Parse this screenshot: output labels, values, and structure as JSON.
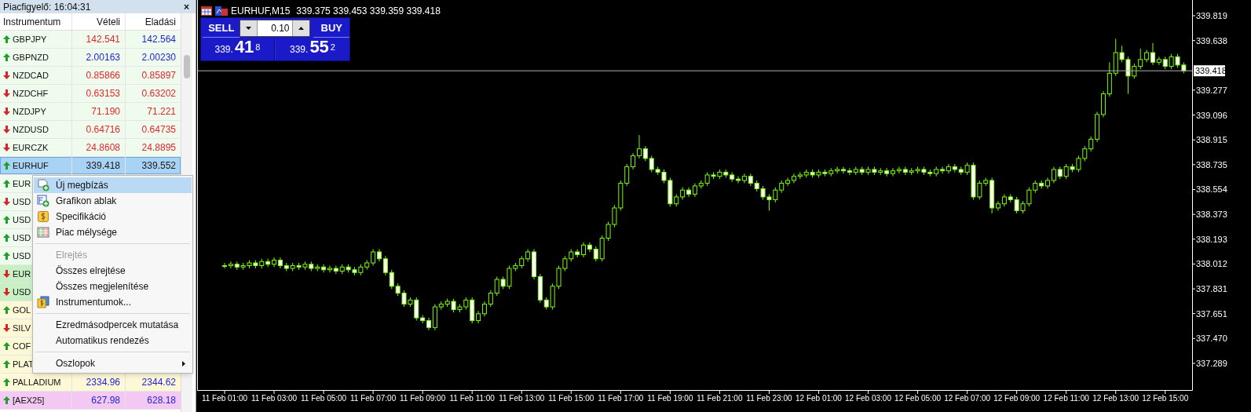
{
  "watch": {
    "title": "Piacfigyelő: 16:04:31",
    "close": "×",
    "columns": [
      "Instrumentum",
      "Vételi",
      "Eladási"
    ],
    "rows": [
      {
        "symbol": "GBPJPY",
        "up": true,
        "color": "#effbec",
        "selected": false,
        "bid": {
          "text": "142.541",
          "color": "#e0262e"
        },
        "ask": {
          "text": "142.564",
          "color": "#1f1fd0"
        }
      },
      {
        "symbol": "GBPNZD",
        "up": true,
        "color": "#effbec",
        "selected": false,
        "bid": {
          "text": "2.00163",
          "color": "#1f1fd0"
        },
        "ask": {
          "text": "2.00230",
          "color": "#1f1fd0"
        }
      },
      {
        "symbol": "NZDCAD",
        "up": false,
        "color": "#effbec",
        "selected": false,
        "bid": {
          "text": "0.85866",
          "color": "#e0262e"
        },
        "ask": {
          "text": "0.85897",
          "color": "#e0262e"
        }
      },
      {
        "symbol": "NZDCHF",
        "up": false,
        "color": "#effbec",
        "selected": false,
        "bid": {
          "text": "0.63153",
          "color": "#e0262e"
        },
        "ask": {
          "text": "0.63202",
          "color": "#e0262e"
        }
      },
      {
        "symbol": "NZDJPY",
        "up": false,
        "color": "#effbec",
        "selected": false,
        "bid": {
          "text": "71.190",
          "color": "#e0262e"
        },
        "ask": {
          "text": "71.221",
          "color": "#e0262e"
        }
      },
      {
        "symbol": "NZDUSD",
        "up": false,
        "color": "#effbec",
        "selected": false,
        "bid": {
          "text": "0.64716",
          "color": "#e0262e"
        },
        "ask": {
          "text": "0.64735",
          "color": "#e0262e"
        }
      },
      {
        "symbol": "EURCZK",
        "up": false,
        "color": "#effbec",
        "selected": false,
        "bid": {
          "text": "24.8608",
          "color": "#e0262e"
        },
        "ask": {
          "text": "24.8895",
          "color": "#e0262e"
        }
      },
      {
        "symbol": "EURHUF",
        "up": true,
        "color": "#a9d3f5",
        "selected": true,
        "bid": {
          "text": "339.418",
          "color": "#1a1a1a"
        },
        "ask": {
          "text": "339.552",
          "color": "#1a1a1a"
        }
      },
      {
        "symbol": "EUR",
        "up": true,
        "color": "#effbec",
        "selected": false
      },
      {
        "symbol": "USD",
        "up": false,
        "color": "#effbec",
        "selected": false
      },
      {
        "symbol": "USD",
        "up": true,
        "color": "#effbec",
        "selected": false
      },
      {
        "symbol": "USD",
        "up": true,
        "color": "#effbec",
        "selected": false
      },
      {
        "symbol": "USD",
        "up": true,
        "color": "#effbec",
        "selected": false
      },
      {
        "symbol": "EUR",
        "up": false,
        "color": "#c9f0c4",
        "selected": false
      },
      {
        "symbol": "USD",
        "up": false,
        "color": "#c9f0c4",
        "selected": false
      },
      {
        "symbol": "GOL",
        "up": true,
        "color": "#fdf8d6",
        "selected": false
      },
      {
        "symbol": "SILV",
        "up": false,
        "color": "#fdf8d6",
        "selected": false
      },
      {
        "symbol": "COF",
        "up": true,
        "color": "#fdf8d6",
        "selected": false
      },
      {
        "symbol": "PLAT",
        "up": true,
        "color": "#fdf8d6",
        "selected": false
      },
      {
        "symbol": "PALLADIUM",
        "up": true,
        "color": "#fdf8d6",
        "selected": false,
        "bid": {
          "text": "2334.96",
          "color": "#1f1fd0"
        },
        "ask": {
          "text": "2344.62",
          "color": "#1f1fd0"
        }
      },
      {
        "symbol": "[AEX25]",
        "up": true,
        "color": "#f3c8f3",
        "selected": false,
        "bid": {
          "text": "627.98",
          "color": "#1f1fd0"
        },
        "ask": {
          "text": "628.18",
          "color": "#1f1fd0"
        }
      }
    ]
  },
  "context_menu": {
    "items": [
      {
        "kind": "item",
        "label": "Új megbízás",
        "selected": true
      },
      {
        "kind": "item",
        "label": "Grafikon ablak",
        "selected": false
      },
      {
        "kind": "item",
        "label": "Specifikáció",
        "selected": false
      },
      {
        "kind": "item",
        "label": "Piac mélysége",
        "selected": false
      },
      {
        "kind": "separator"
      },
      {
        "kind": "disabled",
        "label": "Elrejtés",
        "selected": false
      },
      {
        "kind": "item",
        "label": "Összes elrejtése",
        "selected": false
      },
      {
        "kind": "item",
        "label": "Összes megjelenítése",
        "selected": false
      },
      {
        "kind": "item",
        "label": "Instrumentumok...",
        "selected": false
      },
      {
        "kind": "separator"
      },
      {
        "kind": "item",
        "label": "Ezredmásodpercek mutatása",
        "selected": false
      },
      {
        "kind": "item",
        "label": "Automatikus rendezés",
        "selected": false
      },
      {
        "kind": "separator"
      },
      {
        "kind": "submenu",
        "label": "Oszlopok",
        "selected": false
      }
    ]
  },
  "chart": {
    "title": "EURHUF,M15",
    "ohlc": "339.375 339.453 339.359 339.418",
    "trade_panel": {
      "sell": "SELL",
      "buy": "BUY",
      "lot": "0.10",
      "sell_price": {
        "big": "339.",
        "main": "41",
        "small": "8"
      },
      "buy_price": {
        "big": "339.",
        "main": "55",
        "small": "2"
      }
    },
    "chart_data": {
      "type": "candlestick",
      "ylim": [
        337.095,
        339.933
      ],
      "categories": [
        "11 Feb 01:00",
        null,
        null,
        null,
        null,
        null,
        null,
        null,
        "11 Feb 03:00",
        null,
        null,
        null,
        null,
        null,
        null,
        null,
        "11 Feb 05:00",
        null,
        null,
        null,
        null,
        null,
        null,
        null,
        "11 Feb 07:00",
        null,
        null,
        null,
        null,
        null,
        null,
        null,
        "11 Feb 09:00",
        null,
        null,
        null,
        null,
        null,
        null,
        null,
        "11 Feb 11:00",
        null,
        null,
        null,
        null,
        null,
        null,
        null,
        "11 Feb 13:00",
        null,
        null,
        null,
        null,
        null,
        null,
        null,
        "11 Feb 15:00",
        null,
        null,
        null,
        null,
        null,
        null,
        null,
        "11 Feb 17:00",
        null,
        null,
        null,
        null,
        null,
        null,
        null,
        "11 Feb 19:00",
        null,
        null,
        null,
        null,
        null,
        null,
        null,
        "11 Feb 21:00",
        null,
        null,
        null,
        null,
        null,
        null,
        null,
        "11 Feb 23:00",
        null,
        null,
        null,
        null,
        null,
        null,
        null,
        "12 Feb 01:00",
        null,
        null,
        null,
        null,
        null,
        null,
        null,
        "12 Feb 03:00",
        null,
        null,
        null,
        null,
        null,
        null,
        null,
        "12 Feb 05:00",
        null,
        null,
        null,
        null,
        null,
        null,
        null,
        "12 Feb 07:00",
        null,
        null,
        null,
        null,
        null,
        null,
        null,
        "12 Feb 09:00",
        null,
        null,
        null,
        null,
        null,
        null,
        null,
        "12 Feb 11:00",
        null,
        null,
        null,
        null,
        null,
        null,
        null,
        "12 Feb 13:00",
        null,
        null,
        null,
        null,
        null,
        null,
        null,
        "12 Feb 15:00",
        null,
        null,
        null
      ],
      "yticks": [
        {
          "value": 339.819,
          "label": "339.819"
        },
        {
          "value": 339.638,
          "label": "339.638"
        },
        {
          "value": 339.277,
          "label": "339.277"
        },
        {
          "value": 339.096,
          "label": "339.096"
        },
        {
          "value": 338.915,
          "label": "338.915"
        },
        {
          "value": 338.735,
          "label": "338.735"
        },
        {
          "value": 338.554,
          "label": "338.554"
        },
        {
          "value": 338.373,
          "label": "338.373"
        },
        {
          "value": 338.193,
          "label": "338.193"
        },
        {
          "value": 338.012,
          "label": "338.012"
        },
        {
          "value": 337.831,
          "label": "337.831"
        },
        {
          "value": 337.651,
          "label": "337.651"
        },
        {
          "value": 337.47,
          "label": "337.470"
        },
        {
          "value": 337.289,
          "label": "337.289"
        }
      ],
      "ref_lines": [
        {
          "axis": "y",
          "value": 339.418,
          "label": "339.418"
        }
      ],
      "ohlc": [
        [
          338.0,
          338.02,
          337.98,
          338.0
        ],
        [
          338.0,
          338.03,
          337.98,
          338.01
        ],
        [
          338.01,
          338.03,
          337.97,
          337.99
        ],
        [
          337.99,
          338.02,
          337.97,
          338.0
        ],
        [
          338.0,
          338.04,
          337.98,
          338.02
        ],
        [
          338.02,
          338.04,
          337.98,
          338.0
        ],
        [
          338.0,
          338.05,
          337.98,
          338.03
        ],
        [
          338.03,
          338.05,
          337.99,
          338.01
        ],
        [
          338.01,
          338.06,
          337.99,
          338.04
        ],
        [
          338.04,
          338.06,
          337.98,
          338.0
        ],
        [
          338.0,
          338.02,
          337.96,
          337.98
        ],
        [
          337.98,
          338.02,
          337.96,
          338.0
        ],
        [
          338.0,
          338.02,
          337.97,
          337.99
        ],
        [
          337.99,
          338.03,
          337.97,
          338.01
        ],
        [
          338.01,
          338.03,
          337.96,
          337.98
        ],
        [
          337.98,
          338.01,
          337.96,
          337.99
        ],
        [
          337.99,
          338.01,
          337.95,
          337.97
        ],
        [
          337.97,
          338.0,
          337.95,
          337.98
        ],
        [
          337.98,
          338.0,
          337.94,
          337.96
        ],
        [
          337.96,
          338.01,
          337.94,
          337.99
        ],
        [
          337.99,
          338.01,
          337.95,
          337.97
        ],
        [
          337.97,
          337.99,
          337.93,
          337.95
        ],
        [
          337.95,
          338.01,
          337.93,
          337.99
        ],
        [
          337.99,
          338.04,
          337.97,
          338.02
        ],
        [
          338.02,
          338.12,
          338.0,
          338.1
        ],
        [
          338.1,
          338.12,
          338.03,
          338.05
        ],
        [
          338.05,
          338.07,
          337.93,
          337.95
        ],
        [
          337.95,
          337.97,
          337.83,
          337.85
        ],
        [
          337.85,
          337.87,
          337.78,
          337.8
        ],
        [
          337.8,
          337.82,
          337.7,
          337.72
        ],
        [
          337.72,
          337.77,
          337.7,
          337.75
        ],
        [
          337.75,
          337.77,
          337.6,
          337.62
        ],
        [
          337.62,
          337.64,
          337.58,
          337.6
        ],
        [
          337.6,
          337.62,
          337.53,
          337.55
        ],
        [
          337.55,
          337.72,
          337.53,
          337.7
        ],
        [
          337.7,
          337.74,
          337.68,
          337.72
        ],
        [
          337.72,
          337.76,
          337.7,
          337.74
        ],
        [
          337.74,
          337.76,
          337.66,
          337.68
        ],
        [
          337.68,
          337.72,
          337.66,
          337.7
        ],
        [
          337.7,
          337.77,
          337.68,
          337.75
        ],
        [
          337.75,
          337.77,
          337.58,
          337.6
        ],
        [
          337.6,
          337.67,
          337.58,
          337.65
        ],
        [
          337.65,
          337.74,
          337.63,
          337.72
        ],
        [
          337.72,
          337.82,
          337.7,
          337.8
        ],
        [
          337.8,
          337.92,
          337.78,
          337.9
        ],
        [
          337.9,
          337.92,
          337.83,
          337.85
        ],
        [
          337.85,
          338.0,
          337.83,
          337.98
        ],
        [
          337.98,
          338.02,
          337.96,
          338.0
        ],
        [
          338.0,
          338.07,
          337.98,
          338.05
        ],
        [
          338.05,
          338.12,
          338.03,
          338.1
        ],
        [
          338.1,
          338.12,
          337.9,
          337.92
        ],
        [
          337.92,
          337.94,
          337.73,
          337.75
        ],
        [
          337.75,
          337.77,
          337.68,
          337.7
        ],
        [
          337.7,
          337.87,
          337.68,
          337.85
        ],
        [
          337.85,
          338.0,
          337.83,
          337.98
        ],
        [
          337.98,
          338.07,
          337.96,
          338.05
        ],
        [
          338.05,
          338.12,
          338.03,
          338.1
        ],
        [
          338.1,
          338.12,
          338.06,
          338.08
        ],
        [
          338.08,
          338.17,
          338.06,
          338.15
        ],
        [
          338.15,
          338.17,
          338.1,
          338.12
        ],
        [
          338.12,
          338.14,
          338.03,
          338.05
        ],
        [
          338.05,
          338.22,
          338.03,
          338.2
        ],
        [
          338.2,
          338.32,
          338.18,
          338.3
        ],
        [
          338.3,
          338.44,
          338.28,
          338.42
        ],
        [
          338.42,
          338.62,
          338.4,
          338.6
        ],
        [
          338.6,
          338.74,
          338.58,
          338.72
        ],
        [
          338.72,
          338.82,
          338.7,
          338.8
        ],
        [
          338.8,
          338.95,
          338.78,
          338.85
        ],
        [
          338.85,
          338.87,
          338.76,
          338.78
        ],
        [
          338.78,
          338.8,
          338.68,
          338.7
        ],
        [
          338.7,
          338.72,
          338.66,
          338.68
        ],
        [
          338.68,
          338.7,
          338.6,
          338.62
        ],
        [
          338.62,
          338.64,
          338.43,
          338.45
        ],
        [
          338.45,
          338.52,
          338.43,
          338.5
        ],
        [
          338.5,
          338.57,
          338.48,
          338.55
        ],
        [
          338.55,
          338.57,
          338.5,
          338.52
        ],
        [
          338.52,
          338.6,
          338.5,
          338.58
        ],
        [
          338.58,
          338.62,
          338.56,
          338.6
        ],
        [
          338.6,
          338.68,
          338.58,
          338.66
        ],
        [
          338.66,
          338.68,
          338.63,
          338.65
        ],
        [
          338.65,
          338.7,
          338.63,
          338.68
        ],
        [
          338.68,
          338.7,
          338.64,
          338.66
        ],
        [
          338.66,
          338.68,
          338.61,
          338.63
        ],
        [
          338.63,
          338.65,
          338.6,
          338.62
        ],
        [
          338.62,
          338.67,
          338.6,
          338.65
        ],
        [
          338.65,
          338.67,
          338.58,
          338.6
        ],
        [
          338.6,
          338.62,
          338.54,
          338.56
        ],
        [
          338.56,
          338.58,
          338.48,
          338.5
        ],
        [
          338.5,
          338.52,
          338.4,
          338.48
        ],
        [
          338.48,
          338.57,
          338.46,
          338.55
        ],
        [
          338.55,
          338.62,
          338.53,
          338.6
        ],
        [
          338.6,
          338.64,
          338.58,
          338.62
        ],
        [
          338.62,
          338.67,
          338.6,
          338.65
        ],
        [
          338.65,
          338.68,
          338.63,
          338.66
        ],
        [
          338.66,
          338.7,
          338.64,
          338.68
        ],
        [
          338.68,
          338.7,
          338.64,
          338.66
        ],
        [
          338.66,
          338.7,
          338.64,
          338.68
        ],
        [
          338.68,
          338.7,
          338.65,
          338.67
        ],
        [
          338.67,
          338.71,
          338.65,
          338.69
        ],
        [
          338.69,
          338.72,
          338.67,
          338.7
        ],
        [
          338.7,
          338.72,
          338.67,
          338.69
        ],
        [
          338.69,
          338.71,
          338.66,
          338.68
        ],
        [
          338.68,
          338.72,
          338.66,
          338.7
        ],
        [
          338.7,
          338.72,
          338.66,
          338.68
        ],
        [
          338.68,
          338.72,
          338.66,
          338.7
        ],
        [
          338.7,
          338.72,
          338.66,
          338.68
        ],
        [
          338.68,
          338.71,
          338.66,
          338.69
        ],
        [
          338.69,
          338.71,
          338.65,
          338.67
        ],
        [
          338.67,
          338.71,
          338.65,
          338.69
        ],
        [
          338.69,
          338.72,
          338.67,
          338.7
        ],
        [
          338.7,
          338.72,
          338.66,
          338.68
        ],
        [
          338.68,
          338.71,
          338.66,
          338.69
        ],
        [
          338.69,
          338.72,
          338.67,
          338.7
        ],
        [
          338.7,
          338.72,
          338.66,
          338.68
        ],
        [
          338.68,
          338.7,
          338.65,
          338.67
        ],
        [
          338.67,
          338.72,
          338.65,
          338.7
        ],
        [
          338.7,
          338.72,
          338.67,
          338.69
        ],
        [
          338.69,
          338.74,
          338.67,
          338.72
        ],
        [
          338.72,
          338.74,
          338.68,
          338.7
        ],
        [
          338.7,
          338.72,
          338.66,
          338.68
        ],
        [
          338.68,
          338.75,
          338.66,
          338.73
        ],
        [
          338.73,
          338.75,
          338.48,
          338.5
        ],
        [
          338.5,
          338.62,
          338.48,
          338.6
        ],
        [
          338.6,
          338.64,
          338.58,
          338.62
        ],
        [
          338.62,
          338.64,
          338.38,
          338.42
        ],
        [
          338.42,
          338.47,
          338.4,
          338.45
        ],
        [
          338.45,
          338.52,
          338.43,
          338.5
        ],
        [
          338.5,
          338.52,
          338.46,
          338.48
        ],
        [
          338.48,
          338.5,
          338.38,
          338.4
        ],
        [
          338.4,
          338.47,
          338.38,
          338.45
        ],
        [
          338.45,
          338.57,
          338.43,
          338.55
        ],
        [
          338.55,
          338.62,
          338.53,
          338.6
        ],
        [
          338.6,
          338.62,
          338.56,
          338.58
        ],
        [
          338.58,
          338.64,
          338.56,
          338.62
        ],
        [
          338.62,
          338.72,
          338.6,
          338.7
        ],
        [
          338.7,
          338.72,
          338.63,
          338.65
        ],
        [
          338.65,
          338.74,
          338.63,
          338.72
        ],
        [
          338.72,
          338.74,
          338.68,
          338.7
        ],
        [
          338.7,
          338.8,
          338.68,
          338.78
        ],
        [
          338.78,
          338.87,
          338.76,
          338.85
        ],
        [
          338.85,
          338.94,
          338.83,
          338.92
        ],
        [
          338.92,
          339.12,
          338.9,
          339.1
        ],
        [
          339.1,
          339.27,
          339.08,
          339.25
        ],
        [
          339.25,
          339.48,
          339.23,
          339.4
        ],
        [
          339.4,
          339.65,
          339.38,
          339.55
        ],
        [
          339.55,
          339.6,
          339.48,
          339.5
        ],
        [
          339.5,
          339.52,
          339.25,
          339.38
        ],
        [
          339.38,
          339.47,
          339.36,
          339.45
        ],
        [
          339.45,
          339.58,
          339.43,
          339.5
        ],
        [
          339.5,
          339.57,
          339.48,
          339.55
        ],
        [
          339.55,
          339.62,
          339.46,
          339.48
        ],
        [
          339.48,
          339.52,
          339.46,
          339.5
        ],
        [
          339.5,
          339.52,
          339.43,
          339.45
        ],
        [
          339.45,
          339.54,
          339.43,
          339.52
        ],
        [
          339.52,
          339.54,
          339.44,
          339.46
        ],
        [
          339.46,
          339.48,
          339.4,
          339.418
        ]
      ]
    }
  }
}
